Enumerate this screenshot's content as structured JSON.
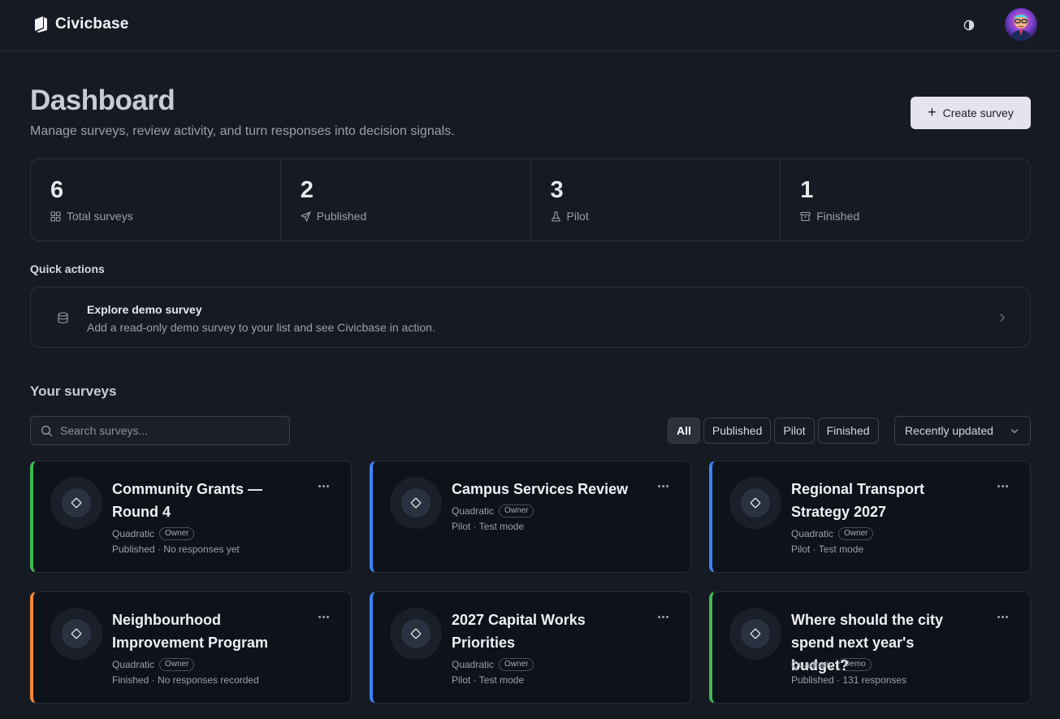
{
  "app": {
    "name": "Civicbase"
  },
  "page": {
    "title": "Dashboard",
    "subtitle": "Manage surveys, review activity, and turn responses into decision signals.",
    "create_button": "Create survey"
  },
  "stats": [
    {
      "value": "6",
      "label": "Total surveys",
      "icon": "grid-icon"
    },
    {
      "value": "2",
      "label": "Published",
      "icon": "send-icon"
    },
    {
      "value": "3",
      "label": "Pilot",
      "icon": "flask-icon"
    },
    {
      "value": "1",
      "label": "Finished",
      "icon": "archive-icon"
    }
  ],
  "quick_actions": {
    "heading": "Quick actions",
    "items": [
      {
        "title": "Explore demo survey",
        "description": "Add a read-only demo survey to your list and see Civicbase in action.",
        "icon": "database-icon"
      }
    ]
  },
  "surveys": {
    "heading": "Your surveys",
    "search_placeholder": "Search surveys...",
    "filters": [
      "All",
      "Published",
      "Pilot",
      "Finished"
    ],
    "active_filter": "All",
    "sort_label": "Recently updated",
    "colors": {
      "published": "#3fb950",
      "pilot": "#3b82f6",
      "finished": "#f0883e"
    },
    "items": [
      {
        "title": "Community Grants — Round 4",
        "method": "Quadratic",
        "role": "Owner",
        "status": "Published · No responses yet",
        "state": "published"
      },
      {
        "title": "Campus Services Review",
        "method": "Quadratic",
        "role": "Owner",
        "status": "Pilot · Test mode",
        "state": "pilot"
      },
      {
        "title": "Regional Transport Strategy 2027",
        "method": "Quadratic",
        "role": "Owner",
        "status": "Pilot · Test mode",
        "state": "pilot"
      },
      {
        "title": "Neighbourhood Improvement Program",
        "method": "Quadratic",
        "role": "Owner",
        "status": "Finished · No responses recorded",
        "state": "finished"
      },
      {
        "title": "2027 Capital Works Priorities",
        "method": "Quadratic",
        "role": "Owner",
        "status": "Pilot · Test mode",
        "state": "pilot"
      },
      {
        "title": "Where should the city spend next year's budget?",
        "method": "Quadratic",
        "role": "Demo",
        "status": "Published · 131 responses",
        "state": "published"
      }
    ]
  }
}
